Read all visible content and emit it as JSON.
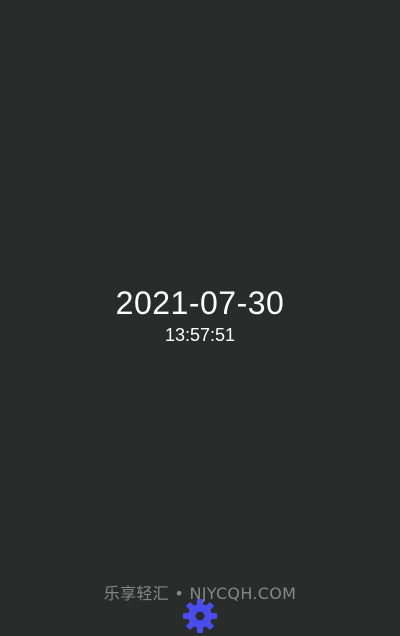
{
  "clock": {
    "date": "2021-07-30",
    "time": "13:57:51"
  },
  "watermark": {
    "text": "乐享轻汇 • NJYCQH.COM"
  },
  "settings_button": {
    "icon": "gear-icon",
    "color": "#4a4cf0"
  },
  "colors": {
    "background": "#2a2b2b",
    "text": "#ffffff",
    "accent": "#4a4cf0"
  }
}
